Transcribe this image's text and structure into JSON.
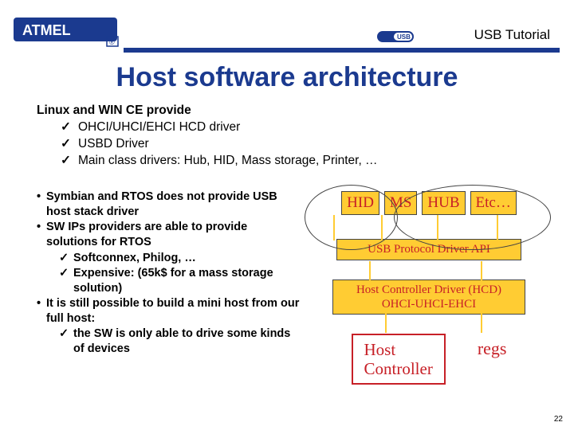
{
  "header": {
    "tutorial": "USB Tutorial",
    "logo_text": "ATMEL"
  },
  "title": "Host software architecture",
  "section1": {
    "heading": "Linux and WIN CE provide",
    "items": [
      "OHCI/UHCI/EHCI HCD driver",
      "USBD Driver",
      "Main class drivers: Hub, HID, Mass storage, Printer, …"
    ]
  },
  "left": {
    "b1": "Symbian and RTOS does not provide USB host stack driver",
    "b2": "SW IPs providers are able to provide solutions for RTOS",
    "b2a": "Softconnex, Philog, …",
    "b2b": "Expensive: (65k$ for a mass storage solution)",
    "b3": "It is still possible to build a mini host from our full host:",
    "b3a": "the SW is only able to drive some kinds of devices"
  },
  "diagram": {
    "top": [
      "HID",
      "MS",
      "HUB",
      "Etc…"
    ],
    "api": "USB Protocol Driver API",
    "hcd_l1": "Host Controller Driver (HCD)",
    "hcd_l2": "OHCI-UHCI-EHCI",
    "hc_l1": "Host",
    "hc_l2": "Controller",
    "regs": "regs"
  },
  "page": "22"
}
